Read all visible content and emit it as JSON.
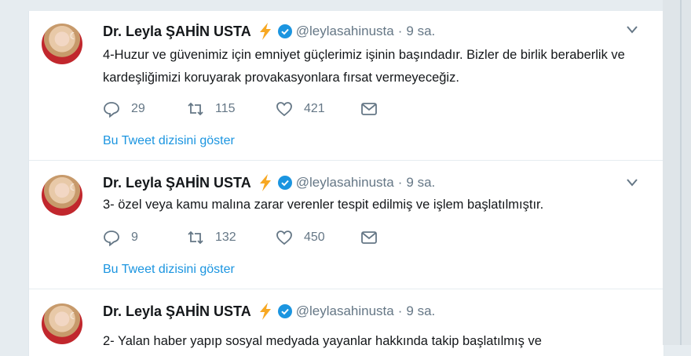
{
  "icons": {
    "reply": "reply-icon",
    "retweet": "retweet-icon",
    "like": "heart-icon",
    "message": "envelope-icon",
    "verified": "verified-badge-icon",
    "bolt": "lightning-bolt-icon",
    "caret": "chevron-down-icon"
  },
  "colors": {
    "accent": "#1b95e0",
    "bolt": "#f7a823",
    "name": "#14171a",
    "secondary": "#657786"
  },
  "tweets": [
    {
      "name": "Dr. Leyla ŞAHİN USTA",
      "handle": "@leylasahinusta",
      "dot": "·",
      "time": "9 sa.",
      "text": "4-Huzur ve güvenimiz için emniyet güçlerimiz işinin başındadır. Bizler de birlik beraberlik ve kardeşliğimizi koruyarak provakasyonlara fırsat vermeyeceğiz.",
      "replies": "29",
      "retweets": "115",
      "likes": "421",
      "thread_link": "Bu Tweet dizisini göster"
    },
    {
      "name": "Dr. Leyla ŞAHİN USTA",
      "handle": "@leylasahinusta",
      "dot": "·",
      "time": "9 sa.",
      "text": "3- özel veya kamu malına zarar verenler tespit edilmiş ve işlem başlatılmıştır.",
      "replies": "9",
      "retweets": "132",
      "likes": "450",
      "thread_link": "Bu Tweet dizisini göster"
    },
    {
      "name": "Dr. Leyla ŞAHİN USTA",
      "handle": "@leylasahinusta",
      "dot": "·",
      "time": "9 sa.",
      "text": "2- Yalan haber yapıp sosyal medyada yayanlar hakkında takip başlatılmış ve"
    }
  ]
}
